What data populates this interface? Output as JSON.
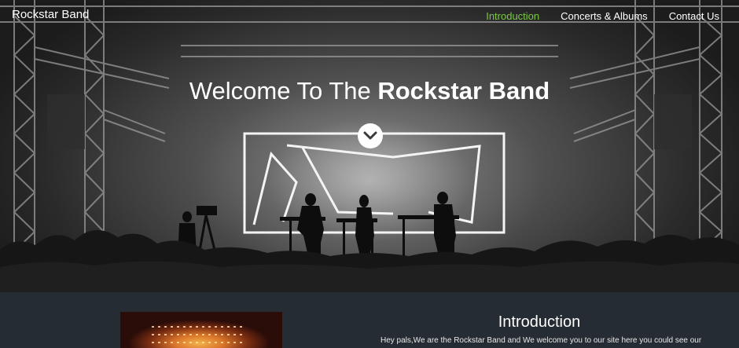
{
  "brand": "Rockstar Band",
  "nav": {
    "items": [
      {
        "label": "Introduction",
        "active": true
      },
      {
        "label": "Concerts & Albums",
        "active": false
      },
      {
        "label": "Contact Us",
        "active": false
      }
    ],
    "active_color": "#7ac943"
  },
  "hero": {
    "title_prefix": "Welcome To The ",
    "title_emphasis": "Rockstar Band",
    "scroll_icon": "chevron-down-icon"
  },
  "intro": {
    "heading": "Introduction",
    "text": "Hey pals,We are the Rockstar Band and We welcome you to our site here you could see our"
  },
  "colors": {
    "section_background": "#262c33",
    "text": "#ffffff"
  }
}
